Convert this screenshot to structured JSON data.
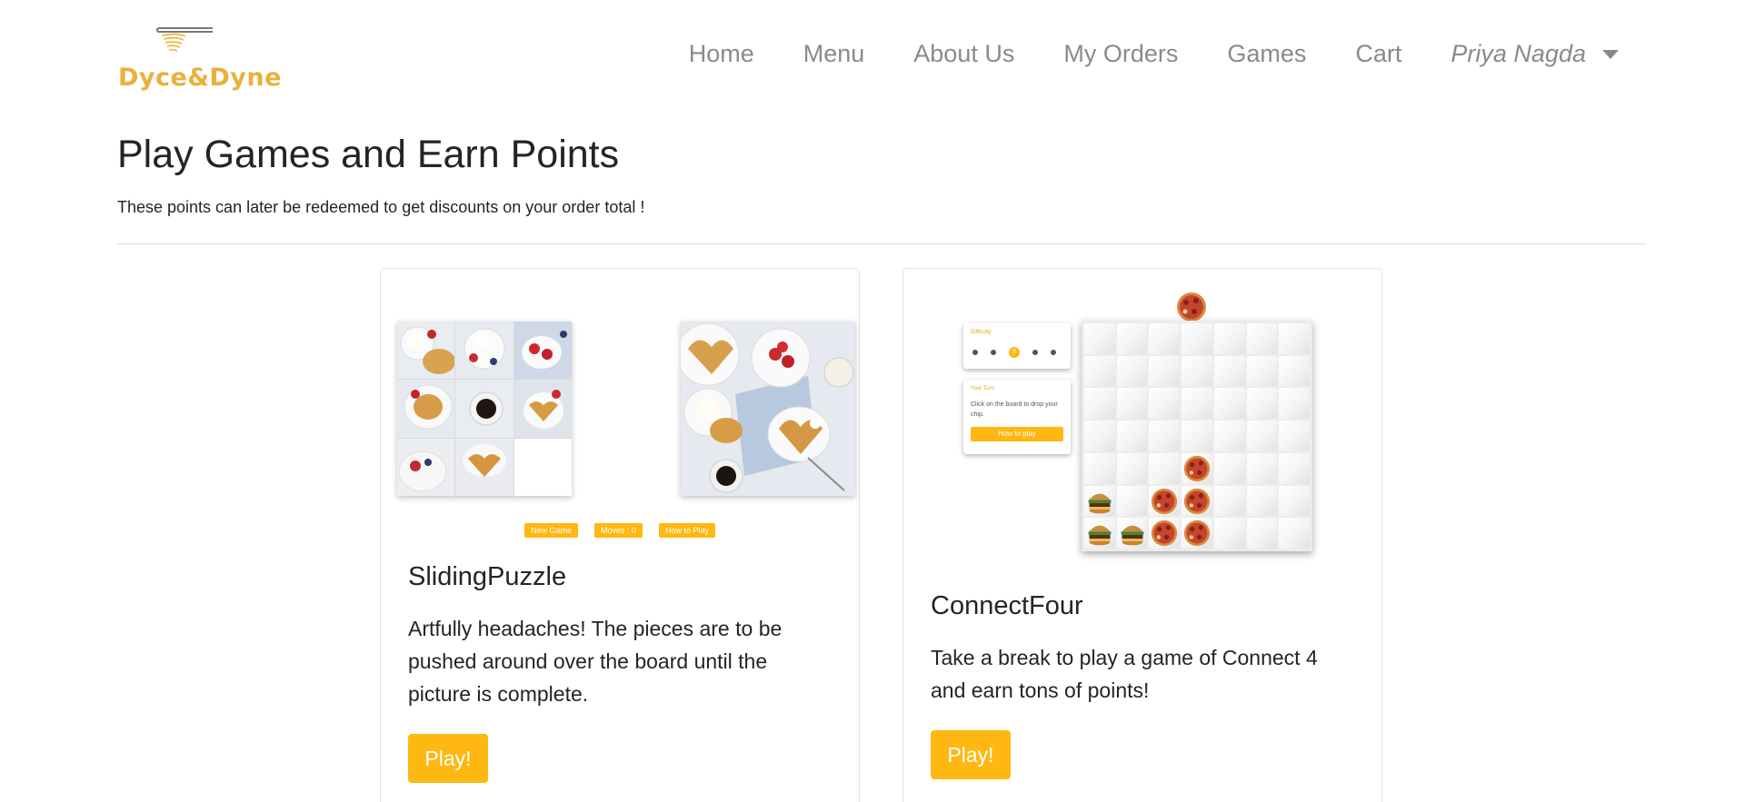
{
  "brand": {
    "name": "Dyce&Dyne"
  },
  "nav": {
    "home": "Home",
    "menu": "Menu",
    "about": "About Us",
    "orders": "My Orders",
    "games": "Games",
    "cart": "Cart",
    "user": "Priya Nagda"
  },
  "header": {
    "title": "Play Games and Earn Points",
    "subtitle": "These points can later be redeemed to get discounts on your order total !"
  },
  "games": [
    {
      "title": "SlidingPuzzle",
      "description": "Artfully headaches! The pieces are to be pushed around over the board until the picture is complete.",
      "button": "Play!",
      "preview": {
        "new_game": "New Game",
        "moves": "Moves : 0",
        "how_to": "How to Play"
      }
    },
    {
      "title": "ConnectFour",
      "description": "Take a break to play a game of Connect 4 and earn tons of points!",
      "button": "Play!",
      "preview": {
        "difficulty_label": "Difficulty",
        "difficulty_value": "3",
        "turn_label": "Your Turn",
        "turn_text": "Click on the board to drop your chip.",
        "how_to": "How to play"
      }
    }
  ],
  "colors": {
    "accent": "#ffb812",
    "brand": "#e9b03a",
    "nav_text": "#8a8a8a"
  }
}
